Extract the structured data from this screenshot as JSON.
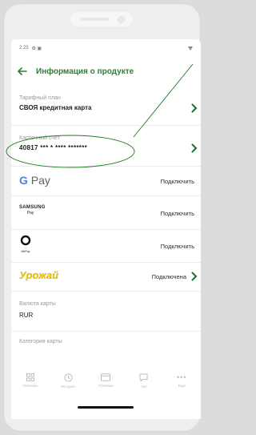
{
  "status": {
    "time": "2:25",
    "icons": "✿ ▣"
  },
  "header": {
    "title": "Информация о продукте"
  },
  "rows": {
    "tariff": {
      "label": "Тарифный план",
      "value": "СВОЯ кредитная карта"
    },
    "account": {
      "label": "Карточный счет",
      "value": "40817 *** * **** *******"
    }
  },
  "payments": {
    "gpay": {
      "logo": "G Pay",
      "action": "Подключить"
    },
    "samsung": {
      "logo_top": "SAMSUNG",
      "logo_bottom": "Pay",
      "action": "Подключить"
    },
    "mirpay": {
      "logo": "MirPay",
      "action": "Подключить"
    },
    "urozhay": {
      "logo": "Урожай",
      "action": "Подключена"
    }
  },
  "currency": {
    "label": "Валюта карты",
    "value": "RUR"
  },
  "category": {
    "label": "Категория карты"
  },
  "nav": {
    "items": [
      {
        "label": "Платежи",
        "icon": "grid-icon"
      },
      {
        "label": "История",
        "icon": "clock-icon"
      },
      {
        "label": "Платежи",
        "icon": "card-icon"
      },
      {
        "label": "Чат",
        "icon": "chat-icon"
      },
      {
        "label": "Ещё",
        "icon": "more-icon"
      }
    ]
  },
  "colors": {
    "brand_green": "#2f7d32",
    "chevron": "#1f6f2a",
    "urozhay_yellow": "#f2c200",
    "annotation": "#1f7a1f"
  }
}
